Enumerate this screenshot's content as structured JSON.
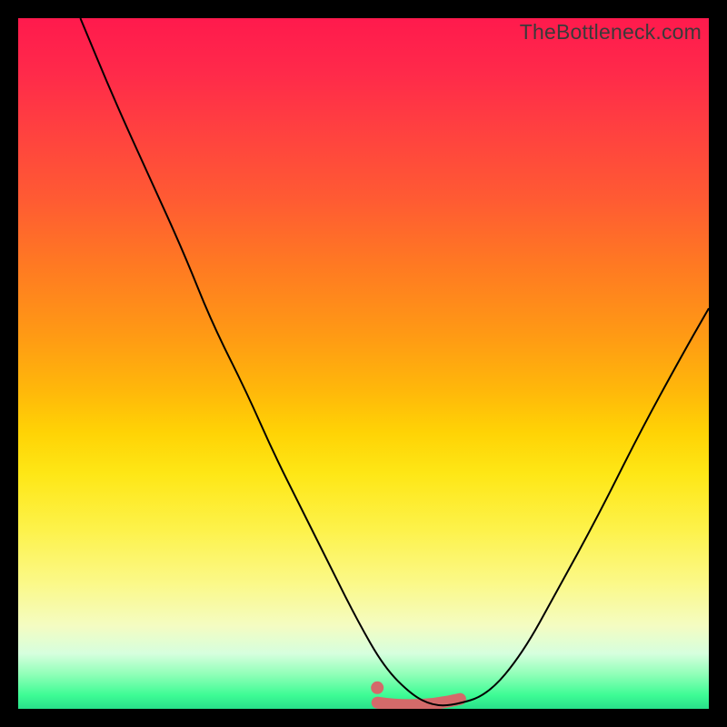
{
  "watermark": "TheBottleneck.com",
  "colors": {
    "frame": "#000000",
    "curve": "#000000",
    "band": "#d46a6a",
    "gradient_top": "#ff1a4d",
    "gradient_bottom": "#28e08a"
  },
  "chart_data": {
    "type": "line",
    "title": "",
    "xlabel": "",
    "ylabel": "",
    "xlim": [
      0,
      100
    ],
    "ylim": [
      0,
      100
    ],
    "description": "Bottleneck severity curve: gradient background red→green top→bottom; black V-shaped curve dipping to ~0 near center; salmon band marks the flat-bottom optimal range.",
    "series": [
      {
        "name": "bottleneck-curve",
        "x": [
          9,
          14,
          19,
          24,
          28,
          33,
          37,
          41,
          45,
          49,
          53,
          57,
          60,
          63,
          68,
          73,
          78,
          84,
          90,
          96,
          100
        ],
        "y": [
          100,
          88,
          77,
          66,
          56,
          46,
          37,
          29,
          21,
          13,
          6,
          2,
          0.5,
          0.5,
          2,
          8,
          17,
          28,
          40,
          51,
          58
        ]
      }
    ],
    "optimal_band": {
      "x_start": 52,
      "x_end": 64,
      "y": 0.5
    },
    "knob": {
      "x": 52,
      "y": 2
    }
  }
}
